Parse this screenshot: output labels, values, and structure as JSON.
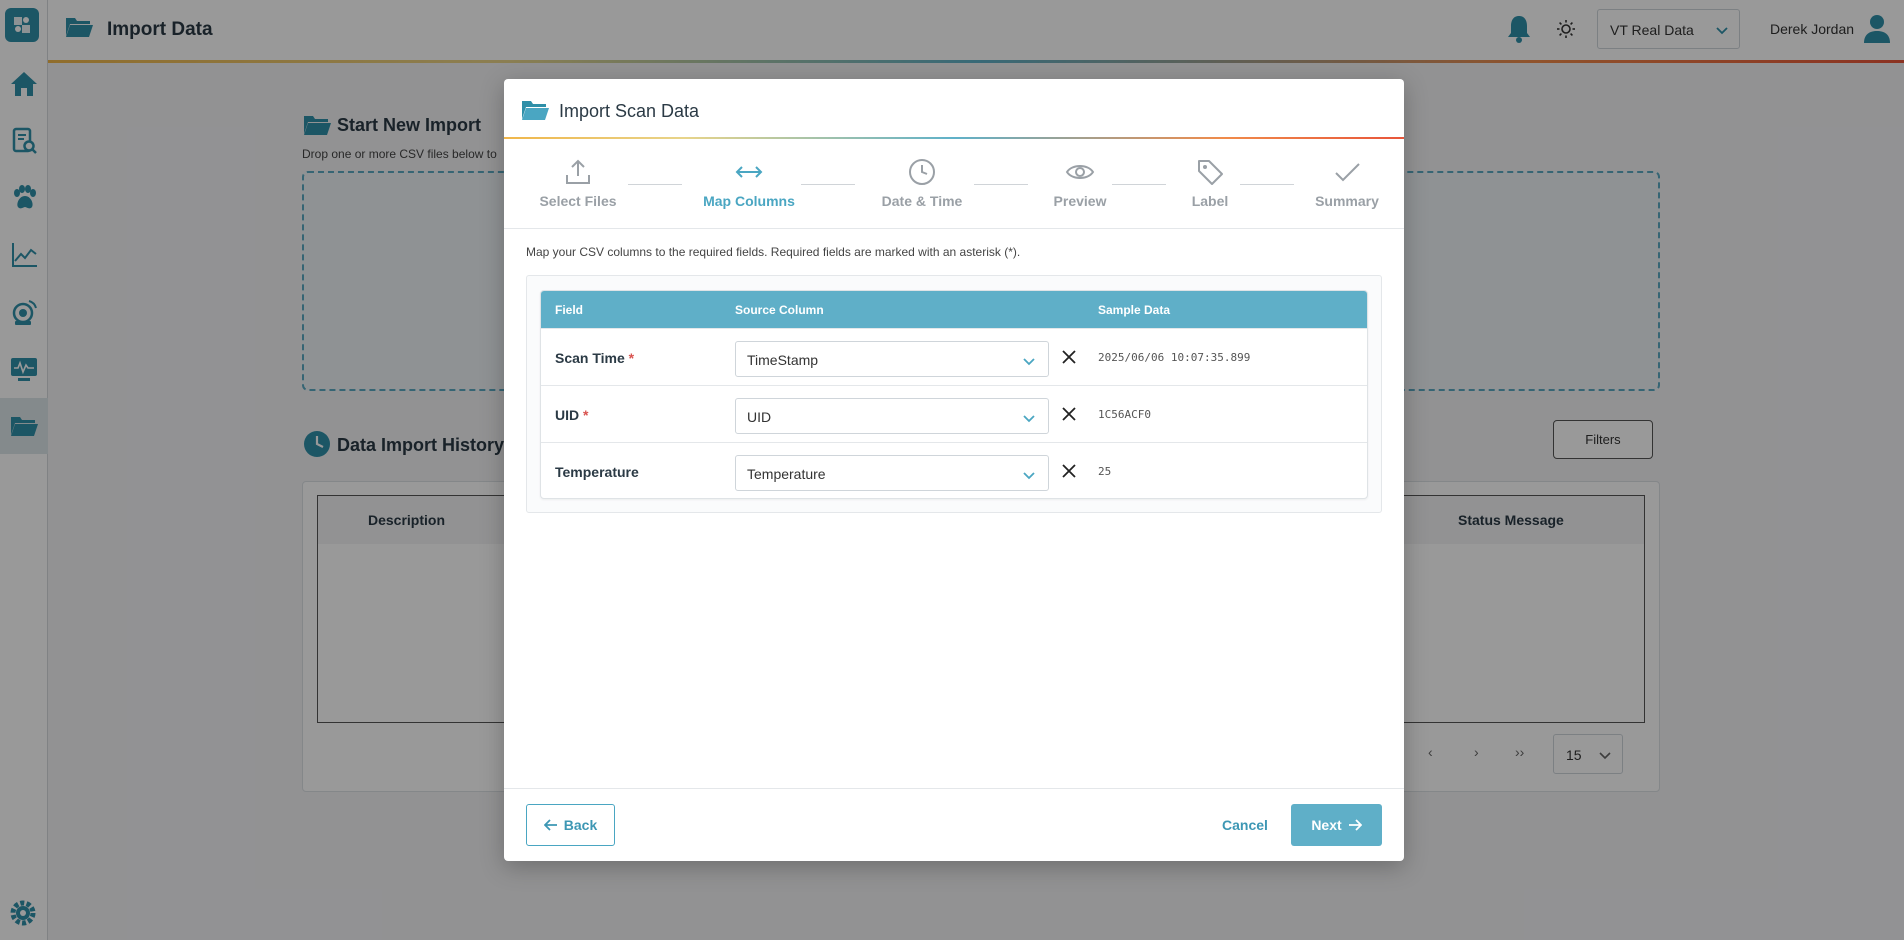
{
  "app": {
    "page_title": "Import Data",
    "dataset_selector": "VT Real Data",
    "user_name": "Derek Jordan"
  },
  "background": {
    "start_title": "Start New Import",
    "start_subtitle": "Drop one or more CSV files below to",
    "history_title": "Data Import History",
    "filters_label": "Filters",
    "history_columns": [
      "Description",
      "Status Message"
    ],
    "page_size": "15",
    "pager": {
      "prev": "‹",
      "next": "›",
      "last": "››"
    }
  },
  "modal": {
    "title": "Import Scan Data",
    "steps": [
      {
        "label": "Select Files",
        "icon": "upload-icon"
      },
      {
        "label": "Map Columns",
        "icon": "arrows-horizontal-icon"
      },
      {
        "label": "Date & Time",
        "icon": "clock-icon"
      },
      {
        "label": "Preview",
        "icon": "eye-icon"
      },
      {
        "label": "Label",
        "icon": "tag-icon"
      },
      {
        "label": "Summary",
        "icon": "check-icon"
      }
    ],
    "active_step": 1,
    "instructions": "Map your CSV columns to the required fields. Required fields are marked with an asterisk (*).",
    "table": {
      "headers": [
        "Field",
        "Source Column",
        "Sample Data"
      ],
      "required_marker": "*",
      "rows": [
        {
          "field": "Scan Time",
          "required": true,
          "source": "TimeStamp",
          "sample": "2025/06/06 10:07:35.899"
        },
        {
          "field": "UID",
          "required": true,
          "source": "UID",
          "sample": "1C56ACF0"
        },
        {
          "field": "Temperature",
          "required": false,
          "source": "Temperature",
          "sample": "25"
        }
      ]
    },
    "buttons": {
      "back": "Back",
      "cancel": "Cancel",
      "next": "Next"
    }
  },
  "colors": {
    "accent": "#5fafc8",
    "required": "#d9534f",
    "sidebar_brand": "#2f8fa8"
  }
}
